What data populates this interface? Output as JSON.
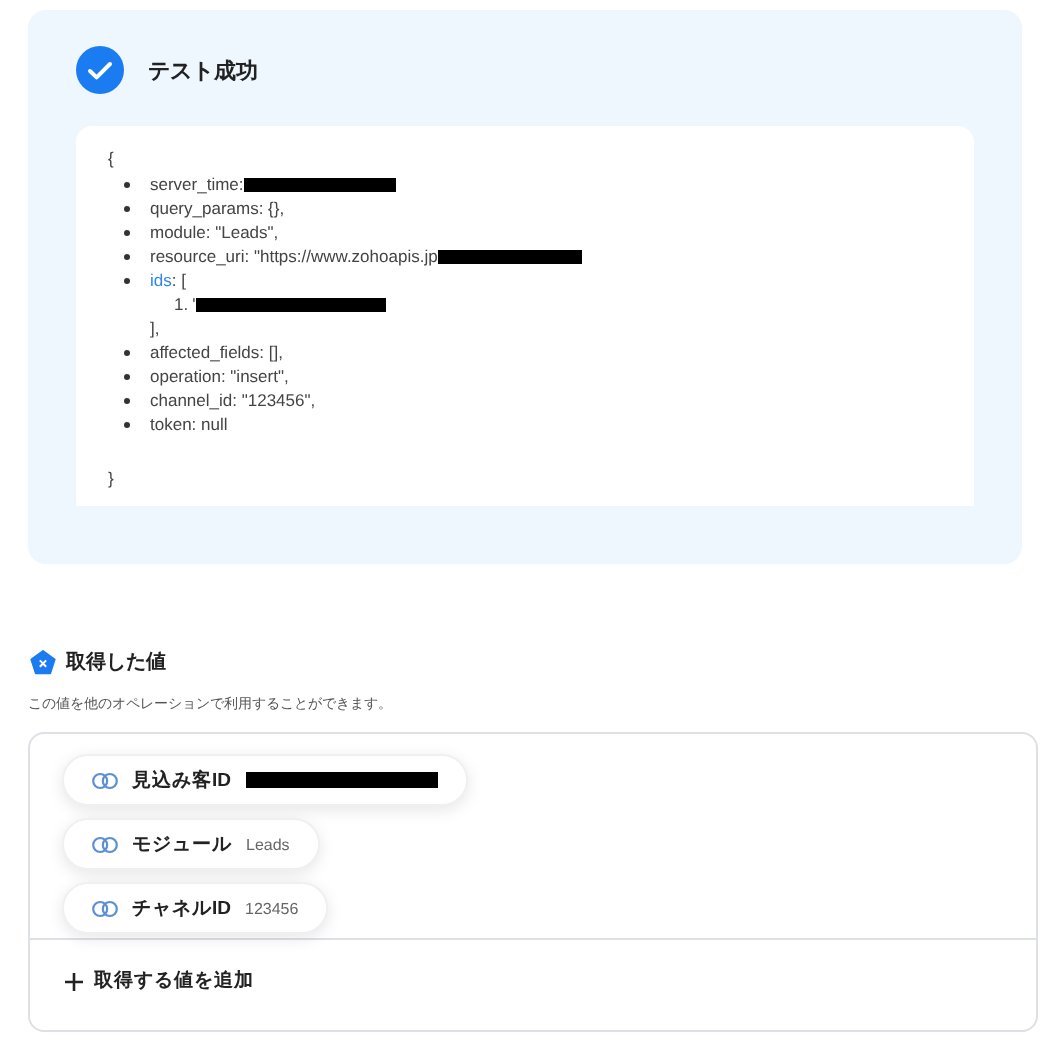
{
  "result": {
    "title": "テスト成功",
    "code": {
      "open": "{",
      "items": [
        {
          "kind": "line",
          "text": "server_time:",
          "redacted": true
        },
        {
          "kind": "line",
          "text": "query_params: {},",
          "redacted": false
        },
        {
          "kind": "line",
          "text": "module: \"Leads\",",
          "redacted": false
        },
        {
          "kind": "line",
          "text": "resource_uri: \"https://www.zohoapis.jp",
          "redacted": true
        },
        {
          "kind": "array",
          "key": "ids",
          "text": ": [",
          "entries": [
            {
              "number": "1.",
              "text": "'",
              "redacted": true
            }
          ],
          "close": "],"
        },
        {
          "kind": "line",
          "text": "affected_fields: [],",
          "redacted": false
        },
        {
          "kind": "line",
          "text": "operation: \"insert\",",
          "redacted": false
        },
        {
          "kind": "line",
          "text": "channel_id: \"123456\",",
          "redacted": false
        },
        {
          "kind": "line",
          "text": "token: null",
          "redacted": false
        }
      ],
      "close": "}"
    }
  },
  "values": {
    "title": "取得した値",
    "description": "この値を他のオペレーションで利用することができます。",
    "items": [
      {
        "label": "見込み客ID",
        "redacted": true
      },
      {
        "label": "モジュール",
        "value": "Leads",
        "redacted": false
      },
      {
        "label": "チャネルID",
        "value": "123456",
        "redacted": false
      }
    ],
    "add_button": "取得する値を追加"
  }
}
